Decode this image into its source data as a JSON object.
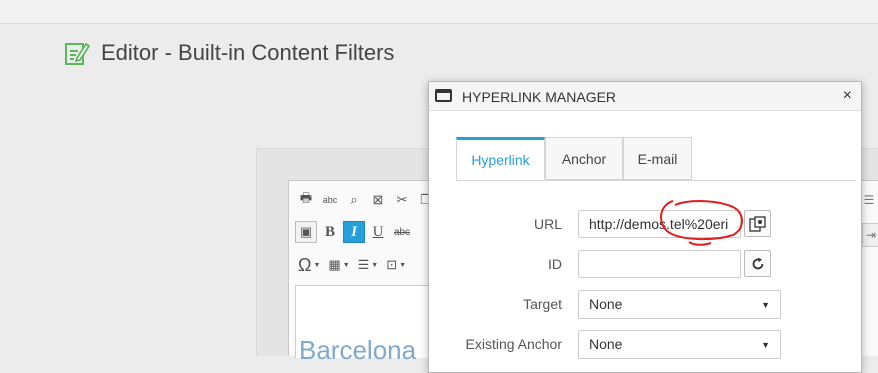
{
  "page": {
    "title": "Editor - Built-in Content Filters"
  },
  "editor": {
    "toolbar_row3_symbol": "Ω",
    "content_text": "Barcelona"
  },
  "dialog": {
    "title": "HYPERLINK MANAGER",
    "close_symbol": "×",
    "tabs": [
      {
        "label": "Hyperlink",
        "active": true
      },
      {
        "label": "Anchor",
        "active": false
      },
      {
        "label": "E-mail",
        "active": false
      }
    ],
    "fields": {
      "url": {
        "label": "URL",
        "value": "http://demos.tel%20eri"
      },
      "id": {
        "label": "ID",
        "value": ""
      },
      "target": {
        "label": "Target",
        "value": "None"
      },
      "existing_anchor": {
        "label": "Existing Anchor",
        "value": "None"
      }
    },
    "icons": {
      "url_button": "document-manager-icon",
      "id_button": "refresh-icon"
    }
  },
  "colors": {
    "accent": "#26a0da",
    "annotation": "#e02020",
    "editor_text": "#7fa9cf",
    "page_icon": "#5cb85c"
  }
}
